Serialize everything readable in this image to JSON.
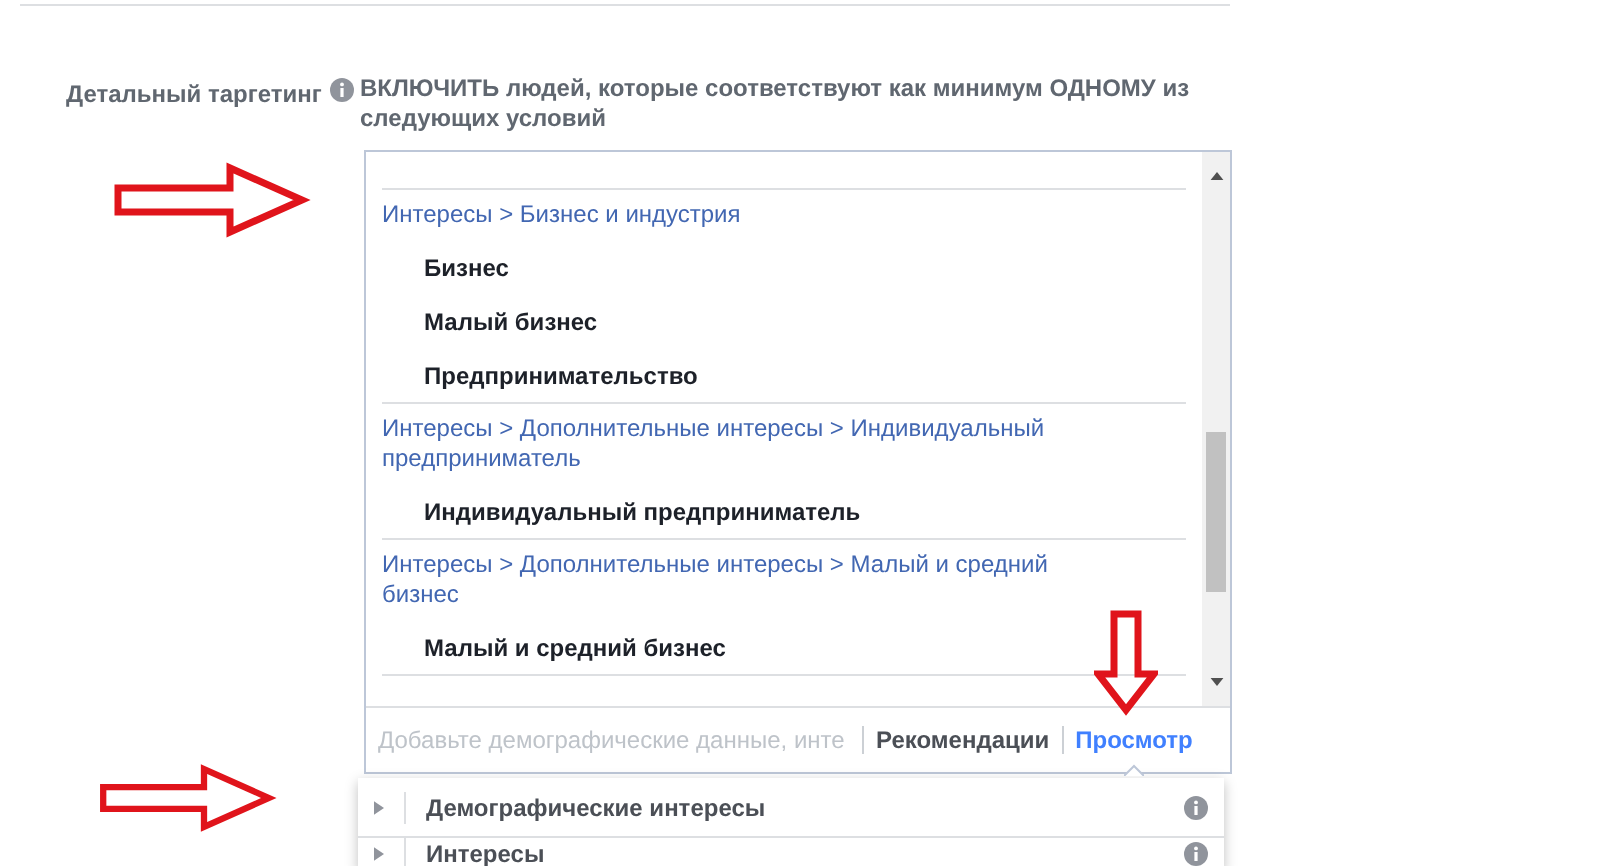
{
  "section": {
    "label": "Детальный таргетинг"
  },
  "heading": "ВКЛЮЧИТЬ людей, которые соответствуют как минимум ОДНОМУ из следующих условий",
  "groups": [
    {
      "path": "Интересы > Бизнес и индустрия",
      "items": [
        "Бизнес",
        "Малый бизнес",
        "Предпринимательство"
      ]
    },
    {
      "path": "Интересы > Дополнительные интересы > Индивидуальный предприниматель",
      "items": [
        "Индивидуальный предприниматель"
      ]
    },
    {
      "path": "Интересы > Дополнительные интересы > Малый и средний бизнес",
      "items": [
        "Малый и средний бизнес"
      ]
    }
  ],
  "search": {
    "placeholder": "Добавьте демографические данные, инте"
  },
  "tabs": [
    {
      "label": "Рекомендации",
      "selected": false
    },
    {
      "label": "Просмотр",
      "selected": true
    }
  ],
  "categories": [
    {
      "label": "Демографические интересы",
      "expanded": false
    },
    {
      "label": "Интересы",
      "expanded": false
    }
  ]
}
